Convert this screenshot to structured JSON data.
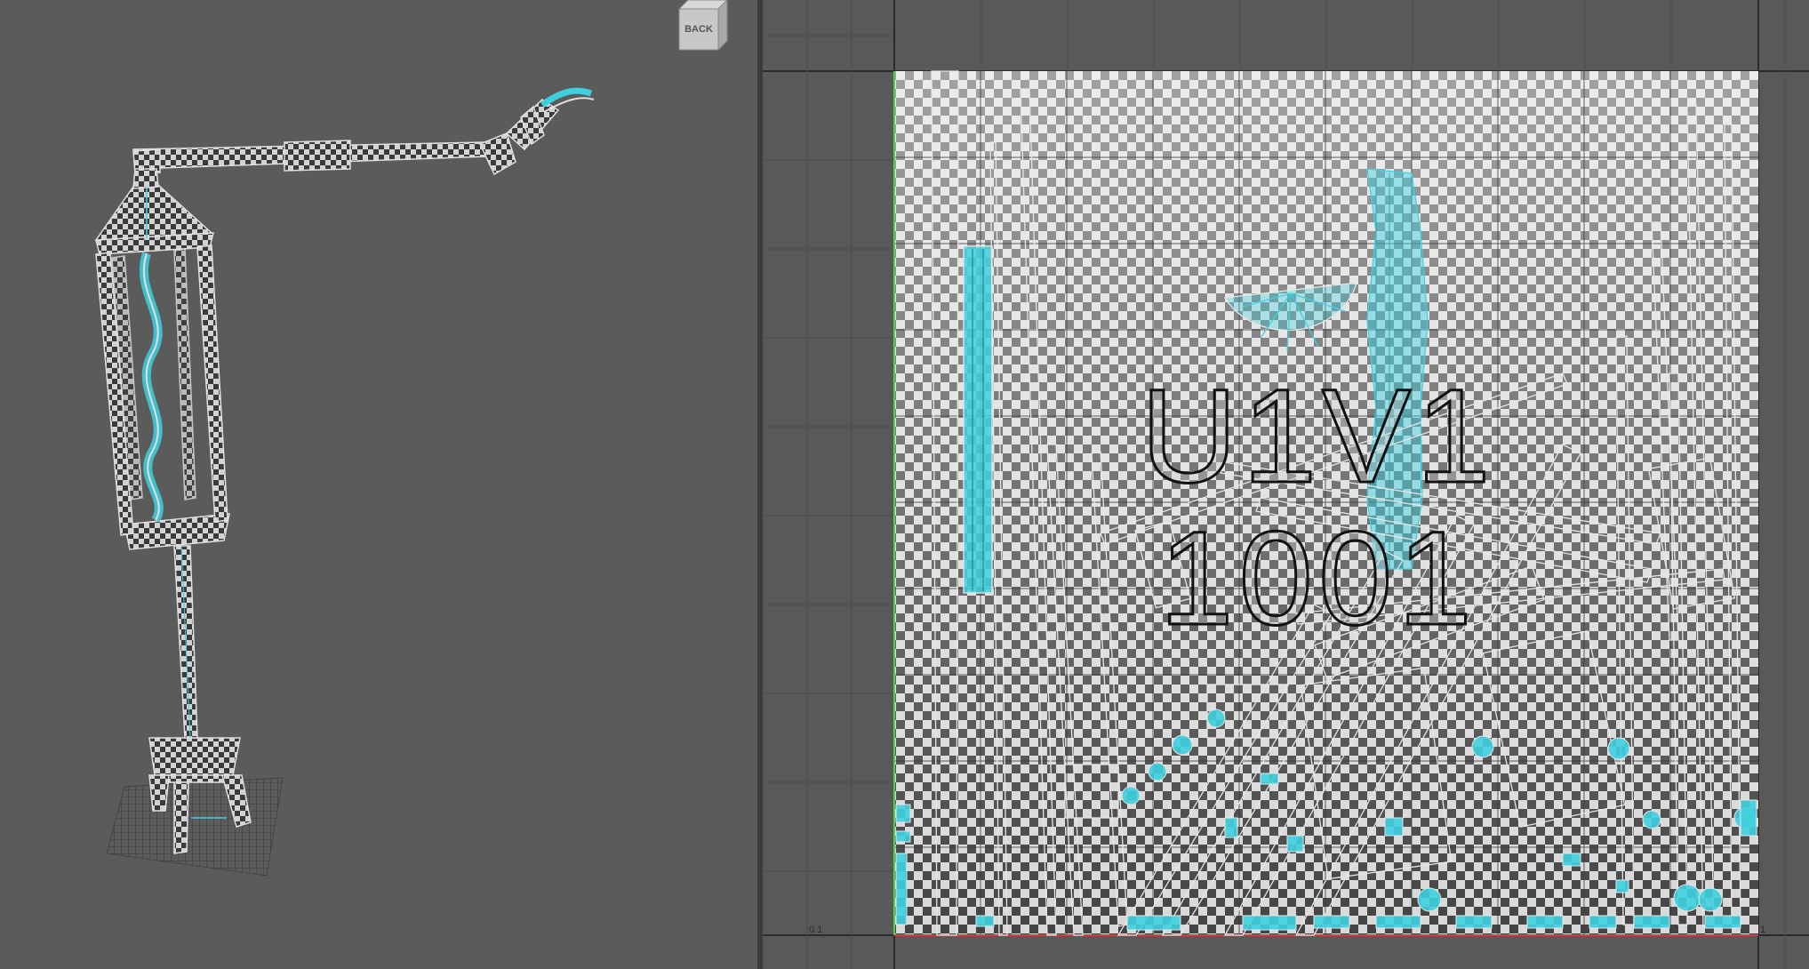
{
  "viewport": {
    "viewcube": {
      "face_label": "BACK",
      "icon": "viewcube-icon"
    }
  },
  "uv_editor": {
    "tile": {
      "uv_label": "U1V1",
      "udim_label": "1001"
    },
    "axis_ticks": {
      "left": "0.1",
      "right": "1"
    },
    "colors": {
      "selection": "#3fd0df",
      "wire": "#e6e6e6",
      "checker_light": "#d4d4d4",
      "checker_dark": "#2f2f2f",
      "background": "#595959",
      "grid": "#484848"
    }
  }
}
